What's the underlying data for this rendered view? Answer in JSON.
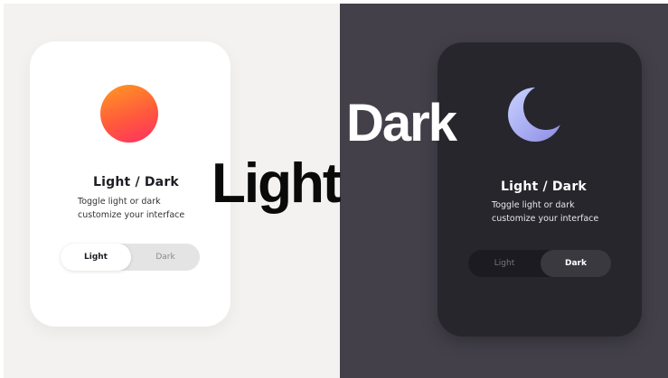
{
  "light_panel": {
    "card": {
      "icon": "sun-icon",
      "title": "Light / Dark",
      "subtitle_line1": "Toggle light or dark",
      "subtitle_line2": "customize your interface",
      "toggle": {
        "option_light": "Light",
        "option_dark": "Dark",
        "selected": "Light"
      }
    },
    "big_label": "Light",
    "colors": {
      "background": "#f3f2f0",
      "card": "#ffffff",
      "sun_start": "#ff9a22",
      "sun_end": "#ff2f62"
    }
  },
  "dark_panel": {
    "card": {
      "icon": "moon-icon",
      "title": "Light / Dark",
      "subtitle_line1": "Toggle light or dark",
      "subtitle_line2": "customize your interface",
      "toggle": {
        "option_light": "Light",
        "option_dark": "Dark",
        "selected": "Dark"
      }
    },
    "big_label": "Dark",
    "colors": {
      "background": "#434049",
      "card": "#27262d",
      "moon_start": "#b7c6ff",
      "moon_end": "#8e8be6"
    }
  }
}
